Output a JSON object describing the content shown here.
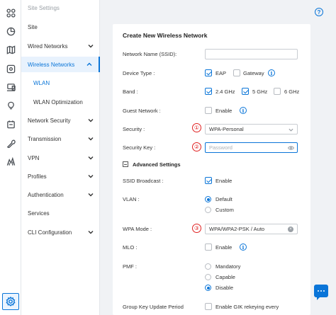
{
  "menu": {
    "header": "Site Settings",
    "items": [
      {
        "label": "Site"
      },
      {
        "label": "Wired Networks"
      },
      {
        "label": "Wireless Networks"
      },
      {
        "label": "WLAN"
      },
      {
        "label": "WLAN Optimization"
      },
      {
        "label": "Network Security"
      },
      {
        "label": "Transmission"
      },
      {
        "label": "VPN"
      },
      {
        "label": "Profiles"
      },
      {
        "label": "Authentication"
      },
      {
        "label": "Services"
      },
      {
        "label": "CLI Configuration"
      }
    ]
  },
  "help": "?",
  "panel": {
    "title": "Create New Wireless Network",
    "network_name": {
      "label": "Network Name (SSID):",
      "value": ""
    },
    "device_type": {
      "label": "Device Type :",
      "options": [
        "EAP",
        "Gateway"
      ],
      "checked": [
        true,
        false
      ]
    },
    "band": {
      "label": "Band :",
      "options": [
        "2.4 GHz",
        "5 GHz",
        "6 GHz"
      ],
      "checked": [
        true,
        true,
        false
      ]
    },
    "guest_network": {
      "label": "Guest Network :",
      "option": "Enable"
    },
    "security": {
      "label": "Security :",
      "value": "WPA-Personal",
      "marker": "①"
    },
    "security_key": {
      "label": "Security Key :",
      "placeholder": "Password",
      "marker": "②"
    },
    "advanced": {
      "label": "Advanced Settings"
    },
    "ssid_broadcast": {
      "label": "SSID Broadcast :",
      "option": "Enable"
    },
    "vlan": {
      "label": "VLAN :",
      "options": [
        "Default",
        "Custom"
      ]
    },
    "wpa_mode": {
      "label": "WPA Mode :",
      "value": "WPA/WPA2-PSK / Auto",
      "marker": "③"
    },
    "mlo": {
      "label": "MLO :",
      "option": "Enable"
    },
    "pmf": {
      "label": "PMF :",
      "options": [
        "Mandatory",
        "Capable",
        "Disable"
      ]
    },
    "gik": {
      "label": "Group Key Update Period",
      "option": "Enable GIK rekeying every"
    }
  },
  "colors": {
    "accent": "#0a75d8",
    "marker": "#e02020"
  },
  "icons": [
    "dashboard-icon",
    "statistics-icon",
    "map-icon",
    "devices-icon",
    "clients-icon",
    "insights-icon",
    "logs-icon",
    "tools-icon",
    "reports-icon",
    "settings-icon"
  ]
}
